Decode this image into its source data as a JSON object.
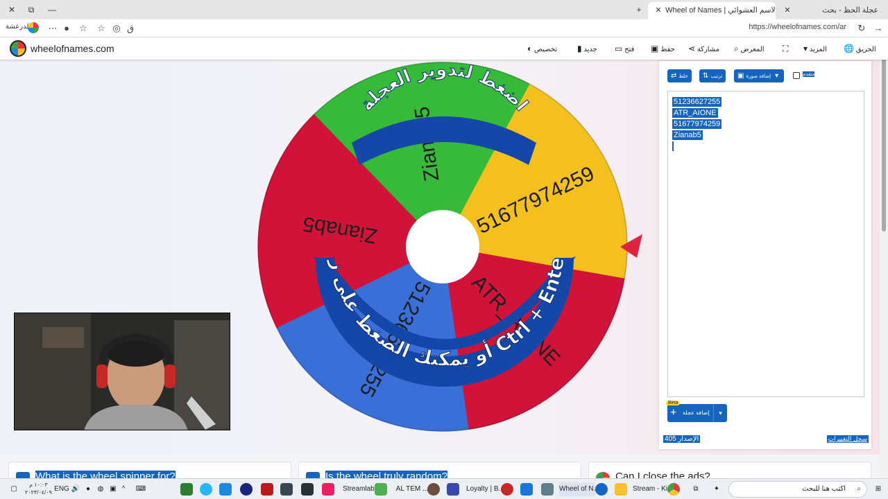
{
  "browser": {
    "tabs": [
      {
        "title": "عجلة الحظ - بحث",
        "active": false
      },
      {
        "title": "Wheel of Names | الاسم العشوائي",
        "active": true
      }
    ],
    "new_tab": "+",
    "window_controls": [
      "✕",
      "⧉",
      "—"
    ],
    "url": "https://wheelofnames.com/ar",
    "profile_name": "الدرعشة"
  },
  "site": {
    "brand": "wheelofnames.com",
    "nav": [
      {
        "label": "الحريق",
        "icon": "globe-icon"
      },
      {
        "label": "المزيد",
        "icon": "chevron-down-icon"
      },
      {
        "label": "",
        "icon": "fullscreen-icon"
      },
      {
        "label": "المعرض",
        "icon": "search-icon"
      },
      {
        "label": "مشاركة",
        "icon": "share-icon"
      },
      {
        "label": "حفظ",
        "icon": "save-icon"
      },
      {
        "label": "فتح",
        "icon": "folder-icon"
      },
      {
        "label": "جديد",
        "icon": "file-icon"
      },
      {
        "label": "تخصيص",
        "icon": "palette-icon"
      }
    ]
  },
  "wheel": {
    "segments": [
      {
        "label": "51677974259",
        "color": "#f4c01e"
      },
      {
        "label": "ATR_AIONE",
        "color": "#d1133a"
      },
      {
        "label": "51236627255",
        "color": "#3a6fd8"
      },
      {
        "label": "Zianab5",
        "color": "#d1133a"
      },
      {
        "label": "Zianab5",
        "color": "#37b93a"
      }
    ],
    "spin_hint_top": "اضغط لتدوير العجلة",
    "spin_hint_bottom": "أو يمكنك الضغط على زر Ctrl + Enter",
    "pointer_color": "#e0233f"
  },
  "panel": {
    "shuffle_label": "خلط",
    "sort_label": "ترتيب",
    "add_image_label": "إضافة صورة",
    "advanced_label": "متقدم",
    "entries": [
      "51236627255",
      "ATR_AIONE",
      "51677974259",
      "Zianab5"
    ],
    "beta_badge": "Beta",
    "add_wheel_label": "إضافة عجلة",
    "version": "الإصدار 405",
    "changelog": "سجل التغييرات"
  },
  "faq": [
    {
      "title": "What is the wheel spinner for?"
    },
    {
      "title": "Is the wheel truly random?"
    },
    {
      "title": "Can I close the ads?"
    }
  ],
  "taskbar": {
    "search_placeholder": "اكتب هنا للبحث",
    "apps": [
      {
        "label": "Stream - Ki...",
        "color": "#5c6bc0"
      },
      {
        "label": "Wheel of N...",
        "color": "#1565c0"
      },
      {
        "label": "Loyalty | B...",
        "color": "#c62828"
      },
      {
        "label": "AL TEM ...",
        "color": "#6d4c41"
      },
      {
        "label": "Streamlabs ...",
        "color": "#2e7d32"
      }
    ],
    "language": "ENG",
    "time": "١٠:٠٣ م",
    "date": "٢٠٢٣/٠٤/٠٩"
  }
}
